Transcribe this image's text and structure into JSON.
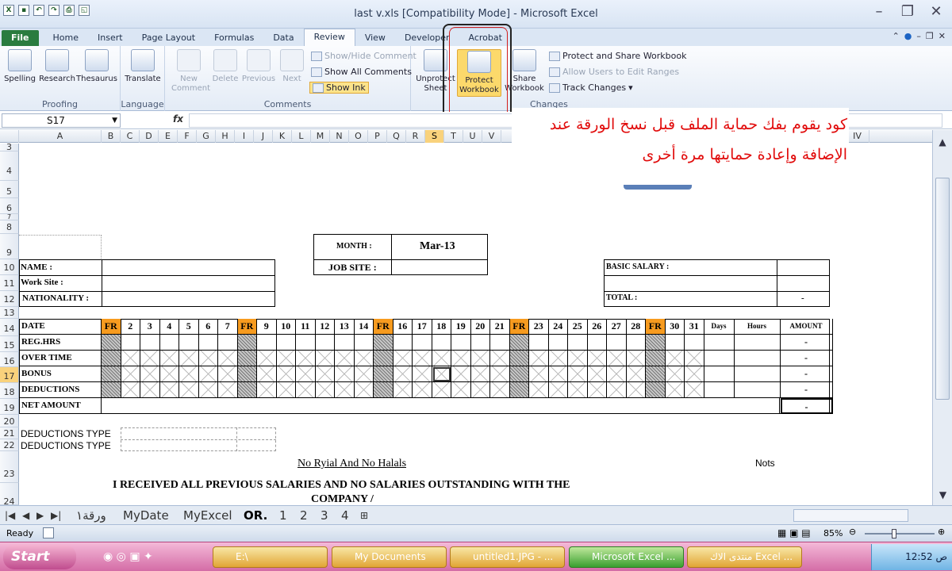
{
  "window": {
    "title": "last v.xls  [Compatibility Mode]  -  Microsoft Excel"
  },
  "tabs": [
    "File",
    "Home",
    "Insert",
    "Page Layout",
    "Formulas",
    "Data",
    "Review",
    "View",
    "Developer",
    "Acrobat"
  ],
  "ribbon": {
    "proofing": {
      "spelling": "Spelling",
      "research": "Research",
      "thesaurus": "Thesaurus",
      "group": "Proofing"
    },
    "language": {
      "translate": "Translate",
      "group": "Language"
    },
    "comments": {
      "new": "New\nComment",
      "delete": "Delete",
      "previous": "Previous",
      "next": "Next",
      "show_hide": "Show/Hide Comment",
      "show_all": "Show All Comments",
      "show_ink": "Show Ink",
      "group": "Comments"
    },
    "changes": {
      "unprotect_sheet": "Unprotect\nSheet",
      "protect_workbook": "Protect\nWorkbook",
      "share_workbook": "Share\nWorkbook",
      "protect_share": "Protect and Share Workbook",
      "allow_users": "Allow Users to Edit Ranges",
      "track_changes": "Track Changes",
      "group": "Changes"
    }
  },
  "namebox": "S17",
  "fx": "fx",
  "columns": [
    "A",
    "B",
    "C",
    "D",
    "E",
    "F",
    "G",
    "H",
    "I",
    "J",
    "K",
    "L",
    "M",
    "N",
    "O",
    "P",
    "Q",
    "R",
    "S",
    "T",
    "U",
    "V",
    "IV"
  ],
  "rows": [
    "3",
    "4",
    "5",
    "6",
    "7",
    "8",
    "9",
    "10",
    "11",
    "12",
    "13",
    "14",
    "15",
    "16",
    "17",
    "18",
    "19",
    "20",
    "21",
    "22",
    "23",
    "24"
  ],
  "annotation": {
    "line1": "كود يقوم بفك حماية الملف قبل نسخ الورقة عند",
    "line2": "الإضافة وإعادة حمايتها مرة أخرى"
  },
  "form": {
    "month_label": "MONTH :",
    "month_value": "Mar-13",
    "jobsite_label": "JOB SITE :",
    "name_label": "NAME   :",
    "worksite_label": "Work Site :",
    "nationality_label": "NATIONALITY :",
    "basic_salary_label": "BASIC SALARY :",
    "total_label": "TOTAL          :",
    "total_value": "-",
    "date_label": "DATE",
    "days": [
      "FR",
      "2",
      "3",
      "4",
      "5",
      "6",
      "7",
      "FR",
      "9",
      "10",
      "11",
      "12",
      "13",
      "14",
      "FR",
      "16",
      "17",
      "18",
      "19",
      "20",
      "21",
      "FR",
      "23",
      "24",
      "25",
      "26",
      "27",
      "28",
      "FR",
      "30",
      "31"
    ],
    "days_hdr": "Days",
    "hours_hdr": "Hours",
    "amount_hdr": "AMOUNT",
    "row_labels": [
      "REG.HRS",
      "OVER TIME",
      "BONUS",
      "DEDUCTIONS"
    ],
    "amounts": [
      "-",
      "-",
      "-",
      "-"
    ],
    "net_label": "NET AMOUNT",
    "net_value": "-",
    "ded_type1": "DEDUCTIONS TYPE",
    "ded_type2": "DEDUCTIONS TYPE",
    "no_riyal": "No Ryial And No Halals",
    "nots": "Nots",
    "received": "I RECEIVED ALL PREVIOUS SALARIES AND NO SALARIES OUTSTANDING WITH THE",
    "company": "COMPANY /"
  },
  "sheet_tabs": [
    "ورقة١",
    "MyDate",
    "MyExcel",
    "OR.",
    "1",
    "2",
    "3",
    "4"
  ],
  "status": {
    "ready": "Ready",
    "zoom": "85%"
  },
  "taskbar": {
    "start": "Start",
    "items": [
      "E:\\",
      "My Documents",
      "untitled1.JPG - ...",
      "Microsoft Excel ...",
      "منتدى الاك Excel ..."
    ],
    "time": "12:52 ص"
  }
}
